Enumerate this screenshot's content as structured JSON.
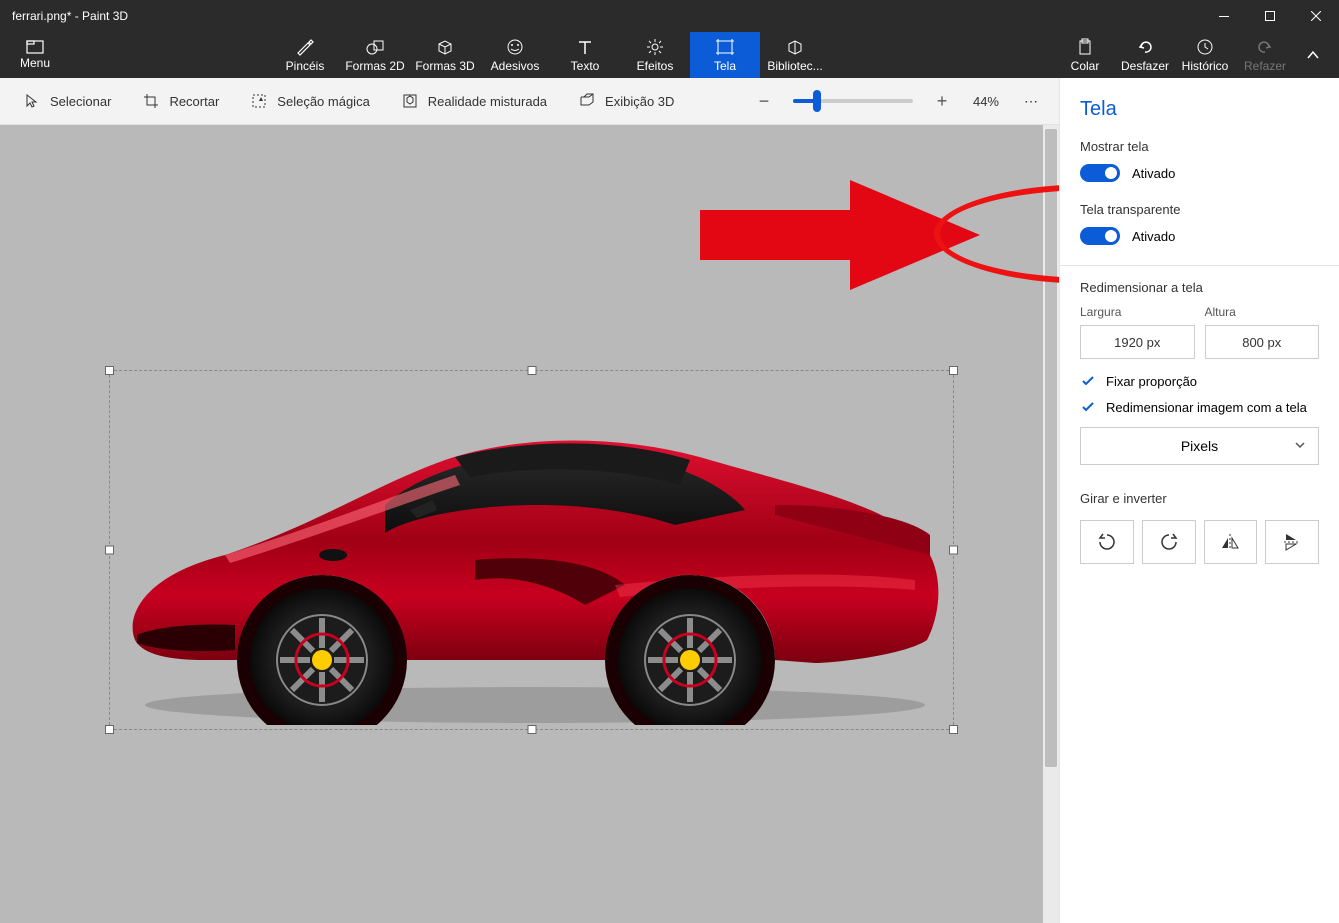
{
  "window": {
    "title": "ferrari.png* - Paint 3D"
  },
  "menu": {
    "label": "Menu"
  },
  "tools": [
    {
      "id": "brushes",
      "label": "Pincéis"
    },
    {
      "id": "shapes2d",
      "label": "Formas 2D"
    },
    {
      "id": "shapes3d",
      "label": "Formas 3D"
    },
    {
      "id": "stickers",
      "label": "Adesivos"
    },
    {
      "id": "text",
      "label": "Texto"
    },
    {
      "id": "effects",
      "label": "Efeitos"
    },
    {
      "id": "canvas",
      "label": "Tela",
      "active": true
    },
    {
      "id": "library",
      "label": "Bibliotec..."
    }
  ],
  "right_tools": {
    "paste": "Colar",
    "undo": "Desfazer",
    "history": "Histórico",
    "redo": "Refazer"
  },
  "subtoolbar": {
    "select": "Selecionar",
    "crop": "Recortar",
    "magic": "Seleção mágica",
    "mixed": "Realidade misturada",
    "view3d": "Exibição 3D",
    "zoom": "44%"
  },
  "panel": {
    "title": "Tela",
    "show_canvas_label": "Mostrar tela",
    "show_canvas_state": "Ativado",
    "transparent_label": "Tela transparente",
    "transparent_state": "Ativado",
    "resize_label": "Redimensionar a tela",
    "width_label": "Largura",
    "height_label": "Altura",
    "width_value": "1920 px",
    "height_value": "800 px",
    "lock_ratio": "Fixar proporção",
    "resize_image": "Redimensionar imagem com a tela",
    "units": "Pixels",
    "rotate_label": "Girar e inverter"
  }
}
